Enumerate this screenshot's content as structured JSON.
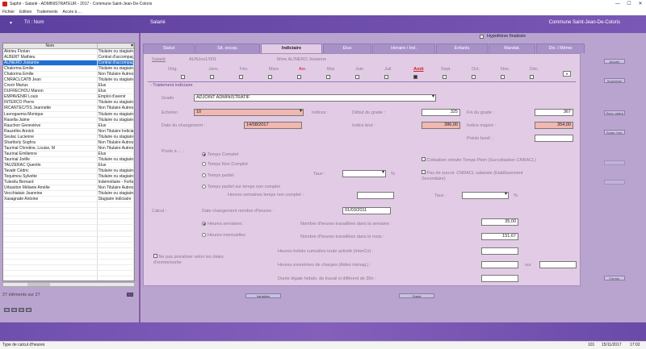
{
  "window": {
    "title": "Saphir - Salarié - ADMINISTRATEUR - 2017 - Commune Saint-Jean-De-Coloris",
    "minimize": "—",
    "maximize": "☐",
    "close": "✕"
  },
  "menu": [
    "Fichier",
    "Edition",
    "Traitements",
    "Accès à ..."
  ],
  "header": {
    "caret": "▾",
    "tri_label": "Tri : Nom",
    "section": "Salarié",
    "commune": "Commune Saint-Jean-De-Coloris"
  },
  "list": {
    "columns": [
      "Nom",
      ""
    ],
    "rows": [
      [
        "Akirieu Florian",
        "Titulaire ou stagiaire"
      ],
      [
        "ALBERT Mathieu",
        "Contrat d'accompag"
      ],
      [
        "ALINERO Josianne",
        "Contrat d'accompag"
      ],
      [
        "Chalorma Emilie",
        "Titulaire ou stagiaire"
      ],
      [
        "Chalorma Emilie",
        "Non Titulaire Autres"
      ],
      [
        "CNRACLCATB Jean",
        "Titulaire ou stagiaire"
      ],
      [
        "Crezir Marius",
        "Elus"
      ],
      [
        "DUFRECHOU Manon",
        "Elus"
      ],
      [
        "EMPAVENIR Louis",
        "Emploi d'avenir"
      ],
      [
        "INTERCO Pierre",
        "Titulaire ou stagiaire"
      ],
      [
        "IRCANTEC/TIS Jeannette",
        "Non Titulaire Autres"
      ],
      [
        "Lavrogaema Monique",
        "Titulaire ou stagiaire"
      ],
      [
        "Rasella-Jaime",
        "Titulaire ou stagiaire"
      ],
      [
        "Rauchon Geneviève",
        "Elus"
      ],
      [
        "Rauzélès Annick",
        "Non Titulaire Indicia"
      ],
      [
        "Seulac Lucienne",
        "Titulaire ou stagiaire"
      ],
      [
        "Sharttoriy Soghra",
        "Non Titulaire Autres"
      ],
      [
        "Taurinal Christine, Louise, M",
        "Non Titulaire Autres"
      ],
      [
        "Taurinal Emilienne",
        "Elus"
      ],
      [
        "Taurinal Joëlle",
        "Titulaire ou stagiaire"
      ],
      [
        "TAUZERAC Quentin",
        "Elus"
      ],
      [
        "Tavatir Cédric",
        "Titulaire ou stagiaire"
      ],
      [
        "Tequimou Sylvette",
        "Titulaire ou stagiaire"
      ],
      [
        "Tulesitu Bernard",
        "Indemnitaire - Forfa"
      ],
      [
        "Urbasiton Mélanie Amélie",
        "Non Titulaire Autres"
      ],
      [
        "Vecchiataio Jeannine",
        "Titulaire ou stagiaire"
      ],
      [
        "Xasagrade Antoine",
        "Stagiaire indiciaire"
      ]
    ],
    "selected_index": 2,
    "count_label": "27 éléments sur 27"
  },
  "hypothese": "Hypothèse finalisée",
  "tabs": [
    "Statut",
    "Sit. excep.",
    "Indiciaire",
    "Elus",
    "Horaire / Ind.",
    "Enfants",
    "Mandat.",
    "Div. / Mémo"
  ],
  "active_tab": 2,
  "employee": {
    "label": "Salarié",
    "matricule": "AUNJos1/001",
    "name": "Mme ALINERO Josianne"
  },
  "months": [
    "Orig.",
    "Janv.",
    "Fév.",
    "Mars",
    "Avr.",
    "Mai",
    "Juin",
    "Juil.",
    "Août",
    "Sept.",
    "Oct.",
    "Nov.",
    "Déc."
  ],
  "section_title": "- Traitement indiciaire",
  "grade": {
    "label": "Grade",
    "value": "ADJOINT ADMINISTRATIF"
  },
  "echelon": {
    "label": "Echelon",
    "value": "10"
  },
  "indices": {
    "label": "Indices :",
    "debut_label": "Début du grade :",
    "debut_value": "325",
    "fin_label": "Fin du grade :",
    "fin_value": "367",
    "brut_label": "Indice brut :",
    "brut_value": "386,00",
    "majore_label": "Indice majoré :",
    "majore_value": "354,00",
    "bonif_label": "Points bonif. :",
    "bonif_value": ""
  },
  "date_changement": {
    "label": "Date du changement :",
    "value": "14/08/2017"
  },
  "poste": {
    "label": "Poste à ... :",
    "options": [
      "Temps Complet",
      "Temps Non Complet",
      "Temps partiel",
      "Temps partiel sur temps non complet"
    ],
    "taux_label": "Taux :",
    "pct": "%",
    "hnc_label": "Heures semaines temps non complet :",
    "taux2_label": "Taux :",
    "pct2": "%",
    "cotisation_label": "Cotisation retraite Temps Plein (Surcotisation CNRACL)",
    "pas_surcot_label": "Pas de surcot. CNRACL salariale (Etablissement Secondaire)"
  },
  "calcul": {
    "label": "Calcul :",
    "date_label": "Date changement nombre d'heures :",
    "date_value": "01/03/2011",
    "option1": "Heures semaines",
    "option2": "Heures mensuelles",
    "nb_semaine_label": "Nombre d'heures travaillées dans la semaine :",
    "nb_semaine_value": "35,00",
    "nb_mois_label": "Nombre d'heures travaillées dans le mois :",
    "nb_mois_value": "151,67",
    "proratiser_label": "Ne pas proratiser selon les dates d'entrée/sortie",
    "hebdo_interco_label": "Heures hebdo cumulées toute activité (InterCo) :",
    "exonerees_label": "Heures exonérées de charges (Aides ménag.) :",
    "sur_label": "sur",
    "duree_label": "Durée légale hebdo. de travail si différent de 35h :"
  },
  "side_buttons": [
    "Ajouter",
    "Supprimer",
    "Recp. statut",
    "Suppr. hyp.",
    "",
    "",
    "Fermer"
  ],
  "bottom_buttons": [
    "Variables",
    "Grade"
  ],
  "status": {
    "left": "Type de calcul d'heures",
    "n1": "101",
    "date": "15/11/2017",
    "time": "17:02"
  }
}
